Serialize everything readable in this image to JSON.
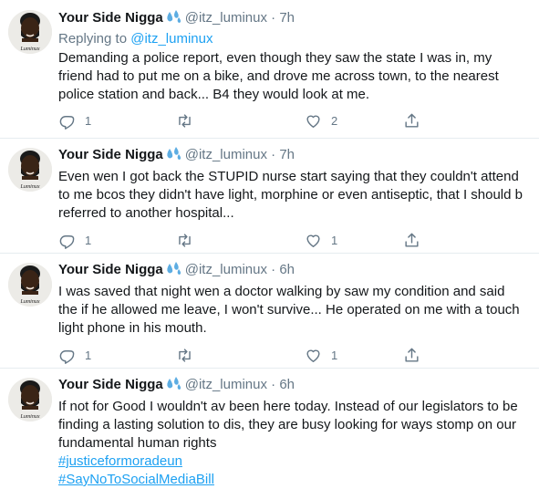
{
  "author": {
    "name": "Your Side Nigga",
    "verified_emoji": "💦",
    "handle": "@itz_luminux",
    "avatar_caption": "Luminux"
  },
  "tweets": [
    {
      "time": "7h",
      "reply_prefix": "Replying to ",
      "reply_to": "@itz_luminux",
      "text": "Demanding a police report, even though they saw the state I was in, my friend had to put me on a bike, and drove me across town, to the nearest police station and back... B4 they would look at me.",
      "replies": "1",
      "retweets": "",
      "likes": "2"
    },
    {
      "time": "7h",
      "text": "Even wen I got back the STUPID nurse start saying that they couldn't attend to me bcos they didn't have light, morphine or even antiseptic, that I should b referred to another hospital...",
      "replies": "1",
      "retweets": "",
      "likes": "1"
    },
    {
      "time": "6h",
      "text": "I was saved that night wen a doctor walking by saw my condition and said the if he allowed me leave, I won't survive... He operated on me with a touch light phone in his mouth.",
      "replies": "1",
      "retweets": "",
      "likes": "1"
    },
    {
      "time": "6h",
      "text": "If not for Good I wouldn't av been here today. Instead of our legislators to be finding a lasting solution to dis, they are busy looking for ways stomp on our fundamental human rights",
      "hashtags": [
        "#justiceformoradeun",
        "#SayNoToSocialMediaBill"
      ]
    }
  ],
  "icons": [
    "reply-icon",
    "retweet-icon",
    "like-icon",
    "share-icon"
  ],
  "colors": {
    "link": "#1da1f2",
    "muted": "#657786",
    "text": "#14171a",
    "divider": "#e6ecf0"
  }
}
